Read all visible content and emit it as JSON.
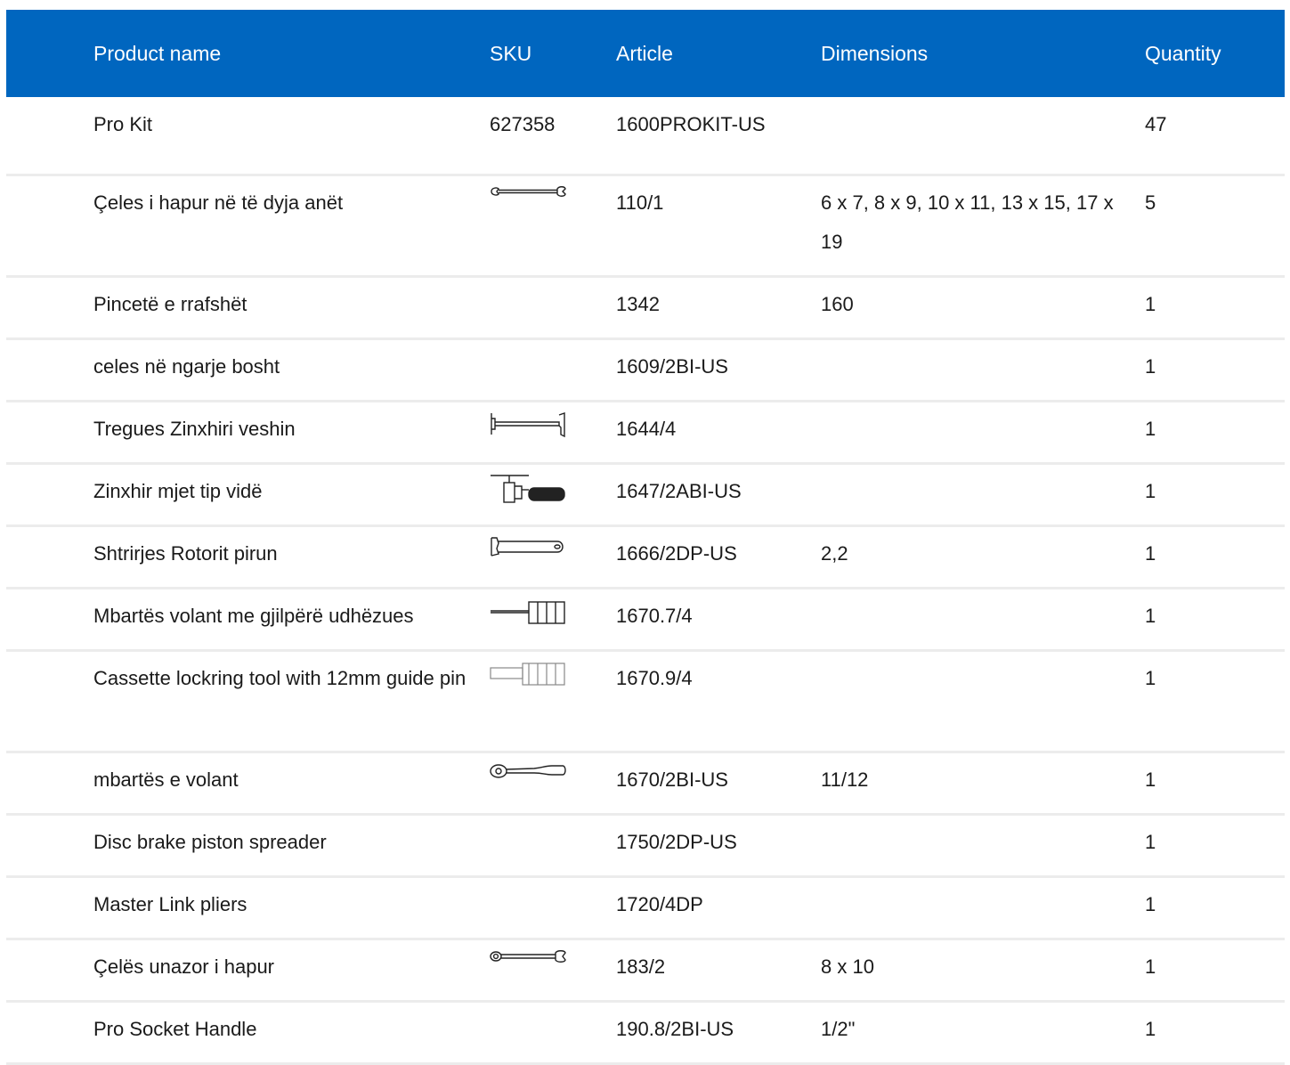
{
  "table": {
    "headers": {
      "name": "Product name",
      "sku": "SKU",
      "article": "Article",
      "dimensions": "Dimensions",
      "quantity": "Quantity"
    },
    "rows": [
      {
        "name": "Pro Kit",
        "sku": "627358",
        "article": "1600PROKIT-US",
        "dimensions": "",
        "quantity": "47",
        "icon": ""
      },
      {
        "name": "Çeles i hapur në të dyja anët",
        "sku": "",
        "article": "110/1",
        "dimensions": "6 x 7, 8 x 9, 10 x 11, 13 x 15, 17 x 19",
        "quantity": "5",
        "icon": "open-end-wrench-icon"
      },
      {
        "name": "Pincetë e rrafshët",
        "sku": "",
        "article": "1342",
        "dimensions": "160",
        "quantity": "1",
        "icon": ""
      },
      {
        "name": "celes në ngarje bosht",
        "sku": "",
        "article": "1609/2BI-US",
        "dimensions": "",
        "quantity": "1",
        "icon": ""
      },
      {
        "name": "Tregues Zinxhiri veshin",
        "sku": "",
        "article": "1644/4",
        "dimensions": "",
        "quantity": "1",
        "icon": "chain-wear-gauge-icon"
      },
      {
        "name": "Zinxhir mjet tip vidë",
        "sku": "",
        "article": "1647/2ABI-US",
        "dimensions": "",
        "quantity": "1",
        "icon": "chain-tool-icon"
      },
      {
        "name": "Shtrirjes Rotorit pirun",
        "sku": "",
        "article": "1666/2DP-US",
        "dimensions": "2,2",
        "quantity": "1",
        "icon": "rotor-truing-fork-icon"
      },
      {
        "name": "Mbartës volant me gjilpërë udhëzues",
        "sku": "",
        "article": "1670.7/4",
        "dimensions": "",
        "quantity": "1",
        "icon": "freewheel-remover-pin-icon"
      },
      {
        "name": "Cassette lockring tool with 12mm guide pin",
        "sku": "",
        "article": "1670.9/4",
        "dimensions": "",
        "quantity": "1",
        "icon": "cassette-lockring-tool-icon"
      },
      {
        "name": "mbartës e volant",
        "sku": "",
        "article": "1670/2BI-US",
        "dimensions": "11/12",
        "quantity": "1",
        "icon": "ratchet-handle-icon"
      },
      {
        "name": "Disc brake piston spreader",
        "sku": "",
        "article": "1750/2DP-US",
        "dimensions": "",
        "quantity": "1",
        "icon": ""
      },
      {
        "name": "Master Link pliers",
        "sku": "",
        "article": "1720/4DP",
        "dimensions": "",
        "quantity": "1",
        "icon": ""
      },
      {
        "name": "Çelës unazor i hapur",
        "sku": "",
        "article": "183/2",
        "dimensions": "8 x 10",
        "quantity": "1",
        "icon": "combination-wrench-icon"
      },
      {
        "name": "Pro Socket Handle",
        "sku": "",
        "article": "190.8/2BI-US",
        "dimensions": "1/2\"",
        "quantity": "1",
        "icon": ""
      }
    ]
  },
  "colors": {
    "header_bg": "#0066bf",
    "header_text": "#ffffff",
    "row_divider": "#ececec"
  }
}
